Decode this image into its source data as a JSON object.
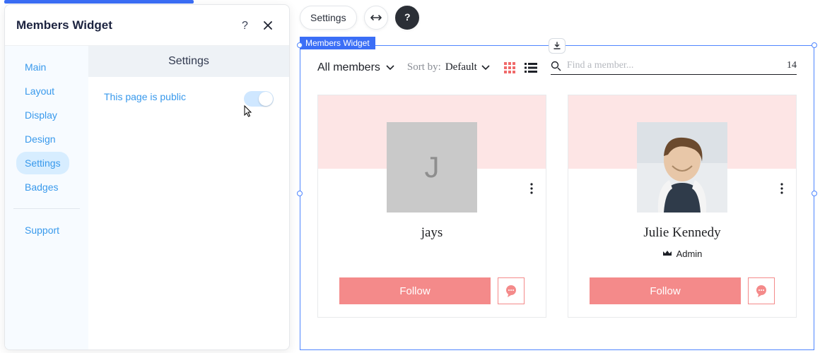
{
  "panel": {
    "title": "Members Widget",
    "section_title": "Settings",
    "nav": [
      "Main",
      "Layout",
      "Display",
      "Design",
      "Settings",
      "Badges"
    ],
    "nav_support": "Support",
    "active_nav_index": 4,
    "setting_label": "This page is public",
    "toggle_on": true
  },
  "pills": {
    "settings": "Settings"
  },
  "widget": {
    "badge": "Members Widget",
    "filter_label": "All members",
    "sort_label": "Sort by:",
    "sort_value": "Default",
    "search_placeholder": "Find a member...",
    "count": "14",
    "members": [
      {
        "name": "jays",
        "initial": "J",
        "role": "",
        "is_admin": false,
        "has_photo": false,
        "follow": "Follow"
      },
      {
        "name": "Julie Kennedy",
        "initial": "",
        "role": "Admin",
        "is_admin": true,
        "has_photo": true,
        "follow": "Follow"
      }
    ]
  },
  "colors": {
    "accent": "#f48a8a",
    "blue": "#3b6ef6"
  }
}
